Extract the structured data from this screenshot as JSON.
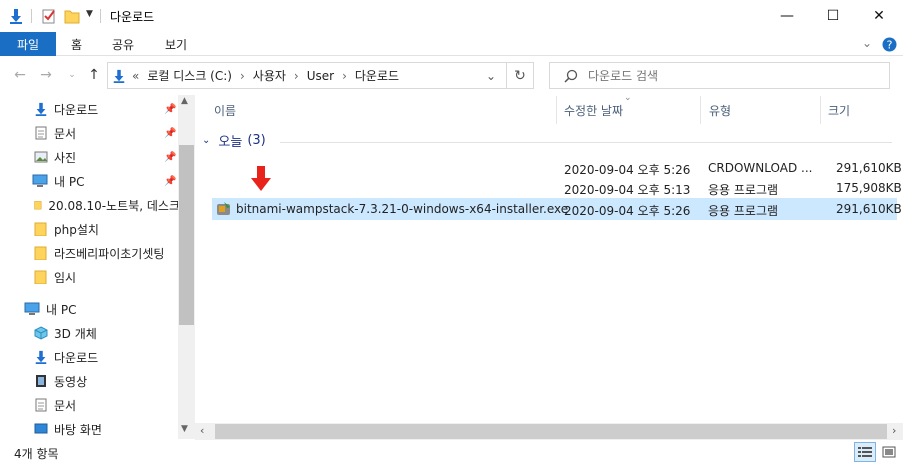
{
  "window": {
    "title": "다운로드",
    "controls": {
      "minimize": "—",
      "maximize": "☐",
      "close": "✕"
    }
  },
  "ribbon": {
    "tabs": [
      {
        "label": "파일",
        "active": true
      },
      {
        "label": "홈"
      },
      {
        "label": "공유"
      },
      {
        "label": "보기"
      }
    ],
    "expand_icon": "chevron-down-icon",
    "help_icon": "help-icon"
  },
  "navigation": {
    "back_icon": "back-arrow-icon",
    "forward_icon": "forward-arrow-icon",
    "up_icon": "up-arrow-icon",
    "address": {
      "prefix": "«",
      "segments": [
        "로컬 디스크 (C:)",
        "사용자",
        "User",
        "다운로드"
      ],
      "separator": "›"
    },
    "refresh_icon": "refresh-icon",
    "search": {
      "placeholder": "다운로드 검색"
    }
  },
  "sidebar": {
    "quick_access": [
      {
        "label": "다운로드",
        "icon": "download-icon",
        "pinned": true
      },
      {
        "label": "문서",
        "icon": "document-icon",
        "pinned": true
      },
      {
        "label": "사진",
        "icon": "picture-icon",
        "pinned": true
      },
      {
        "label": "내 PC",
        "icon": "pc-icon",
        "pinned": true
      },
      {
        "label": "20.08.10-노트북, 데스크",
        "icon": "folder-icon"
      },
      {
        "label": "php설치",
        "icon": "folder-icon"
      },
      {
        "label": "라즈베리파이초기셋팅",
        "icon": "folder-icon"
      },
      {
        "label": "임시",
        "icon": "folder-icon"
      }
    ],
    "this_pc": {
      "label": "내 PC",
      "icon": "pc-icon"
    },
    "pc_items": [
      {
        "label": "3D 개체",
        "icon": "3d-objects-icon"
      },
      {
        "label": "다운로드",
        "icon": "download-icon"
      },
      {
        "label": "동영상",
        "icon": "video-icon"
      },
      {
        "label": "문서",
        "icon": "document-icon"
      },
      {
        "label": "바탕 화면",
        "icon": "desktop-icon"
      }
    ]
  },
  "file_list": {
    "columns": [
      "이름",
      "수정한 날짜",
      "유형",
      "크기"
    ],
    "group": {
      "label": "오늘",
      "count": "(3)"
    },
    "rows": [
      {
        "name": "",
        "date": "2020-09-04 오후 5:26",
        "type": "CRDOWNLOAD ...",
        "size": "291,610KB"
      },
      {
        "name": "",
        "date": "2020-09-04 오후 5:13",
        "type": "응용 프로그램",
        "size": "175,908KB"
      },
      {
        "name": "bitnami-wampstack-7.3.21-0-windows-x64-installer.exe",
        "date": "2020-09-04 오후 5:26",
        "type": "응용 프로그램",
        "size": "291,610KB",
        "selected": true
      }
    ]
  },
  "status_bar": {
    "item_count": "4개 항목"
  },
  "colors": {
    "accent": "#1a6fc4",
    "selection": "#cce8ff",
    "arrow": "#e8231b",
    "group_header": "#1e3287"
  }
}
